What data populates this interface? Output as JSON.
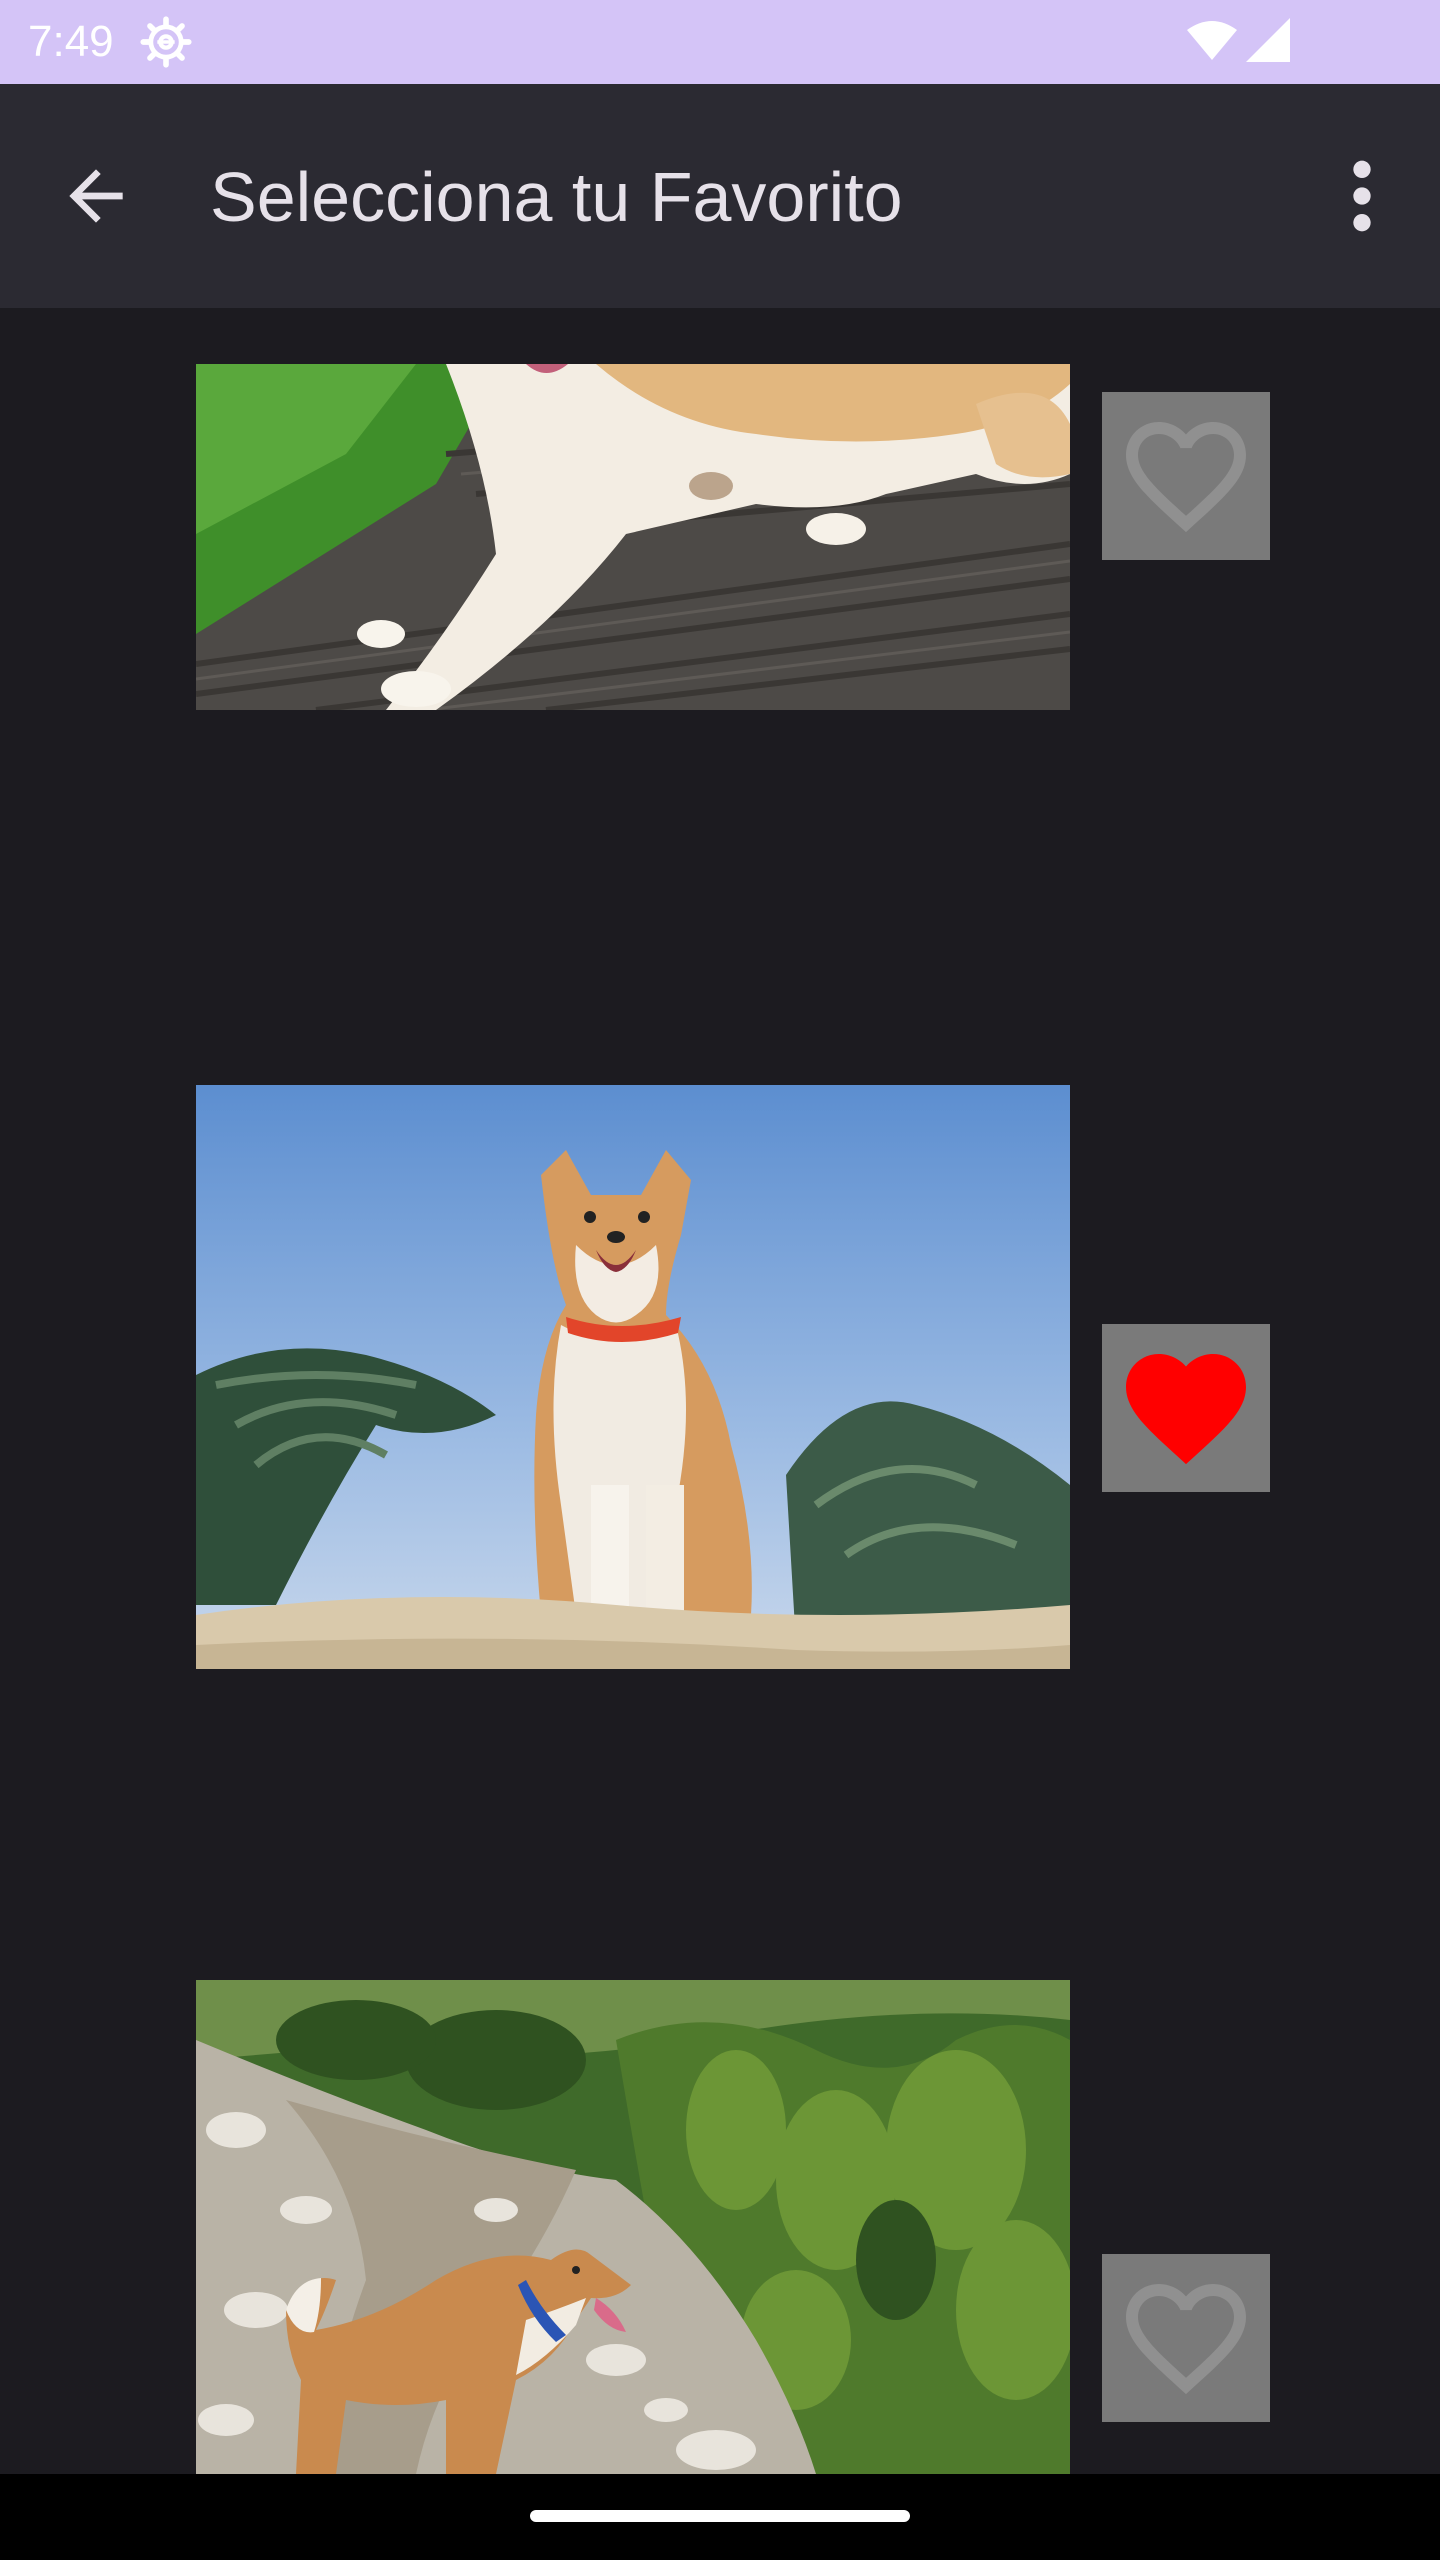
{
  "status_bar": {
    "time": "7:49",
    "background": "#d4c4f7",
    "icons": [
      "gear-icon",
      "wifi-icon",
      "cellular-signal-icon"
    ]
  },
  "app_bar": {
    "title": "Selecciona tu Favorito",
    "back_icon": "arrow-left-icon",
    "menu_icon": "more-vert-icon",
    "background": "#2b2a32"
  },
  "items": [
    {
      "image": "akita-dog-lying-on-wooden-deck-photo",
      "favorite": false
    },
    {
      "image": "akita-dog-standing-on-sand-blue-sky-photo",
      "favorite": true
    },
    {
      "image": "akita-dog-on-rocky-mountain-trail-photo",
      "favorite": false
    }
  ],
  "colors": {
    "background": "#1c1b20",
    "favorite_on": "#ff0000",
    "favorite_off": "#909090",
    "favorite_button_bg": "#7a7a7a"
  },
  "nav_bar": {
    "handle": "gesture-handle"
  }
}
